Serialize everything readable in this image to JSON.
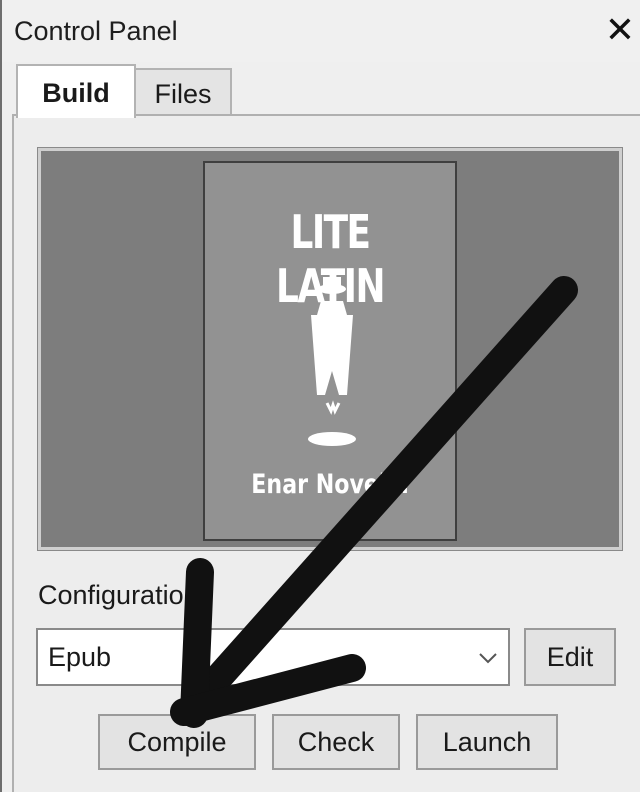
{
  "window": {
    "title": "Control Panel",
    "close_glyph": "✕"
  },
  "tabs": [
    {
      "label": "Build",
      "active": true
    },
    {
      "label": "Files",
      "active": false
    }
  ],
  "preview": {
    "cover_title": "LITE LATIN",
    "cover_author": "Enar Novel…"
  },
  "configuration": {
    "label": "Configuration:",
    "selected": "Epub",
    "edit_label": "Edit"
  },
  "actions": {
    "compile_label": "Compile",
    "check_label": "Check",
    "launch_label": "Launch"
  },
  "icons": {
    "close": "close-icon",
    "dropdown": "chevron-down-icon",
    "annotation": "hand-drawn-arrow"
  },
  "colors": {
    "window_bg": "#efefef",
    "preview_bg": "#7d7d7d",
    "cover_bg": "#929292",
    "arrow": "#111111"
  }
}
